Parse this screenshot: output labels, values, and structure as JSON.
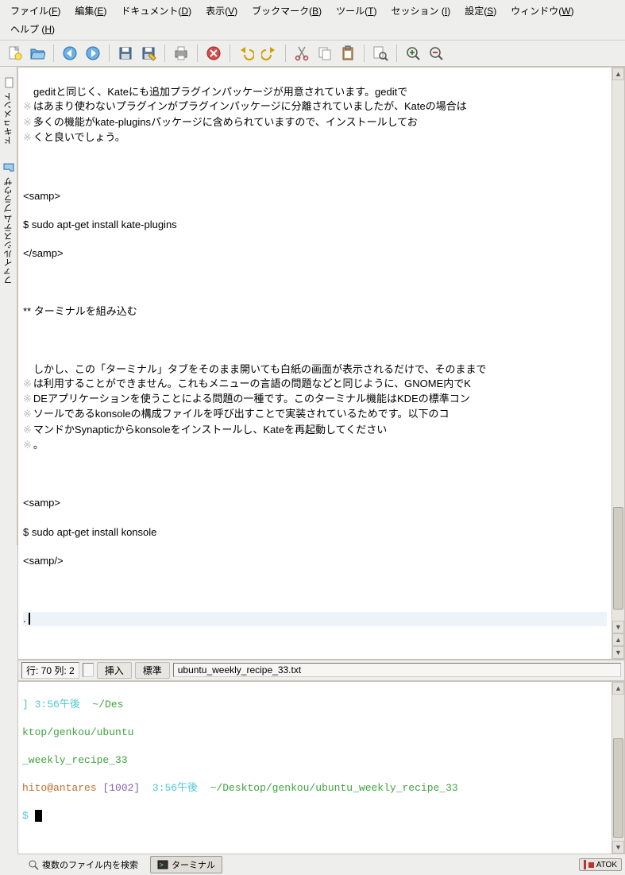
{
  "menu": {
    "file": {
      "label": "ファイル",
      "mnemonic": "F"
    },
    "edit": {
      "label": "編集",
      "mnemonic": "E"
    },
    "document": {
      "label": "ドキュメント",
      "mnemonic": "D"
    },
    "view": {
      "label": "表示",
      "mnemonic": "V"
    },
    "bookmarks": {
      "label": "ブックマーク",
      "mnemonic": "B"
    },
    "tools": {
      "label": "ツール",
      "mnemonic": "T"
    },
    "session": {
      "label": "セッション",
      "mnemonic": "I"
    },
    "settings": {
      "label": "設定",
      "mnemonic": "S"
    },
    "window": {
      "label": "ウィンドウ",
      "mnemonic": "W"
    },
    "help": {
      "label": "ヘルプ",
      "mnemonic": "H"
    }
  },
  "toolbar": [
    {
      "name": "new-file-icon"
    },
    {
      "name": "open-file-icon"
    },
    {
      "sep": true
    },
    {
      "name": "back-icon"
    },
    {
      "name": "forward-icon"
    },
    {
      "sep": true
    },
    {
      "name": "save-icon"
    },
    {
      "name": "save-as-icon"
    },
    {
      "sep": true
    },
    {
      "name": "print-icon"
    },
    {
      "sep": true
    },
    {
      "name": "close-doc-icon"
    },
    {
      "sep": true
    },
    {
      "name": "undo-icon"
    },
    {
      "name": "redo-icon"
    },
    {
      "sep": true
    },
    {
      "name": "cut-icon"
    },
    {
      "name": "copy-icon"
    },
    {
      "name": "paste-icon"
    },
    {
      "sep": true
    },
    {
      "name": "find-icon"
    },
    {
      "sep": true
    },
    {
      "name": "zoom-in-icon"
    },
    {
      "name": "zoom-out-icon"
    }
  ],
  "side_tabs": {
    "documents": "ドキュメント",
    "fs_browser": "ファイルシステム ブラウザ"
  },
  "editor": {
    "para1": "geditと同じく、Kateにも追加プラグインパッケージが用意されています。geditではあまり使わないプラグインがプラグインパッケージに分離されていましたが、Kateの場合は多くの機能がkate-pluginsパッケージに含められていますので、インストールしておくと良いでしょう。",
    "samp_open": "<samp>",
    "cmd1": "$ sudo apt-get install kate-plugins",
    "samp_close": "</samp>",
    "heading": "** ターミナルを組み込む",
    "para2": "しかし、この「ターミナル」タブをそのまま開いても白紙の画面が表示されるだけで、そのままでは利用することができません。これもメニューの言語の問題などと同じように、GNOME内でKDEアプリケーションを使うことによる問題の一種です。このターミナル機能はKDEの標準コンソールであるkonsoleの構成ファイルを呼び出すことで実装されているためです。以下のコマンドかSynapticからkonsoleをインストールし、Kateを再起動してください。",
    "samp2_open": "<samp>",
    "cmd2": "$ sudo apt-get install konsole",
    "samp2_close": "<samp/>",
    "period": "."
  },
  "status": {
    "line_col": "行: 70 列: 2",
    "insert": "挿入",
    "indent": "標準",
    "path": "ubuntu_weekly_recipe_33.txt"
  },
  "terminal": {
    "l1_a": "]",
    "l1_b": " 3:56午後  ",
    "l1_c": "~/Des",
    "l2": "ktop/genkou/ubuntu",
    "l3": "_weekly_recipe_33",
    "l4_a": "hito@antares ",
    "l4_b": "[1002]",
    "l4_c": "  3:56午後  ",
    "l4_d": "~/Desktop/genkou/ubuntu_weekly_recipe_33",
    "l5": "$ "
  },
  "bottom_tabs": {
    "search_in_files": "複数のファイル内を検索",
    "terminal": "ターミナル"
  },
  "im": {
    "label": "ATOK"
  }
}
